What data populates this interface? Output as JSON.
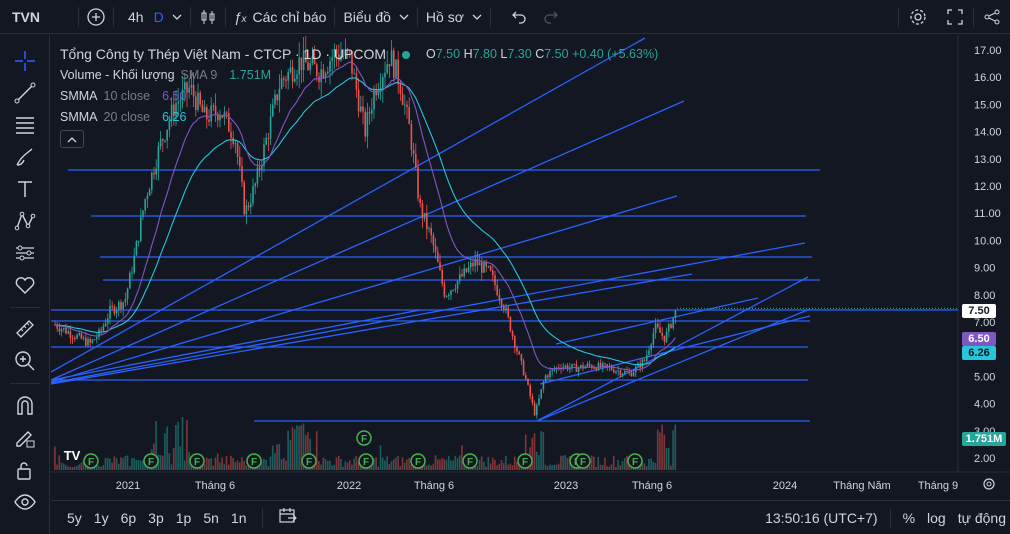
{
  "topbar": {
    "symbol": "TVN",
    "interval": "4h",
    "interval_d": "D",
    "indicators_label": "Các chỉ báo",
    "chart_label": "Biểu đồ",
    "profile_label": "Hồ sơ"
  },
  "legend": {
    "title": "Tổng Công ty Thép Việt Nam - CTCP · 1D · UPCOM",
    "o_label": "O",
    "o_val": "7.50",
    "h_label": "H",
    "h_val": "7.80",
    "l_label": "L",
    "l_val": "7.30",
    "c_label": "C",
    "c_val": "7.50",
    "change": "+0.40 (+5.63%)",
    "volume_label": "Volume - Khối lượng",
    "volume_ind": "SMA 9",
    "volume_val": "1.751M",
    "smma10_label": "SMMA",
    "smma10_param": "10 close",
    "smma10_val": "6.50",
    "smma20_label": "SMMA",
    "smma20_param": "20 close",
    "smma20_val": "6.26"
  },
  "colors": {
    "background": "#131722",
    "accent": "#2962ff",
    "up": "#26a69a",
    "down": "#ef5350",
    "smma10": "#7e57c2",
    "smma20": "#26c6da",
    "trendline": "#2962ff"
  },
  "price_axis": {
    "labels": [
      "17.00",
      "16.00",
      "15.00",
      "14.00",
      "13.00",
      "12.00",
      "11.00",
      "10.00",
      "9.00",
      "8.00",
      "7.00",
      "6.00",
      "5.00",
      "4.00",
      "3.00",
      "2.00"
    ],
    "tags": {
      "last": "7.50",
      "smma10": "6.50",
      "smma20": "6.26",
      "volume": "1.751M"
    }
  },
  "time_axis": {
    "labels": [
      "2021",
      "Tháng 6",
      "2022",
      "Tháng 6",
      "2023",
      "Tháng 6",
      "2024",
      "Tháng Năm",
      "Tháng 9"
    ]
  },
  "bottombar": {
    "ranges": [
      "5y",
      "1y",
      "6p",
      "3p",
      "1p",
      "5n",
      "1n"
    ],
    "clock": "13:50:16 (UTC+7)",
    "percent": "%",
    "log": "log",
    "auto": "tự động"
  },
  "events": {
    "marker_letter": "F",
    "logo_text": "TV"
  },
  "chart_data": {
    "type": "candlestick",
    "x": [
      "2020-10",
      "2020-12",
      "2021-01",
      "2021-03",
      "2021-05",
      "2021-07",
      "2021-09",
      "2021-11",
      "2022-01",
      "2022-02",
      "2022-04",
      "2022-05",
      "2022-07",
      "2022-09",
      "2022-10",
      "2022-11",
      "2022-12",
      "2023-02",
      "2023-04",
      "2023-06",
      "2023-07",
      "2023-08"
    ],
    "close": [
      6.9,
      6.2,
      7.8,
      11.5,
      14.5,
      15.8,
      12.0,
      13.8,
      16.8,
      16.2,
      13.0,
      10.5,
      8.0,
      8.8,
      6.5,
      3.6,
      5.2,
      5.5,
      5.2,
      6.8,
      6.6,
      7.5
    ],
    "last": {
      "open": 7.5,
      "high": 7.8,
      "low": 7.3,
      "close": 7.5
    },
    "ylim": [
      1.5,
      17.3
    ]
  }
}
